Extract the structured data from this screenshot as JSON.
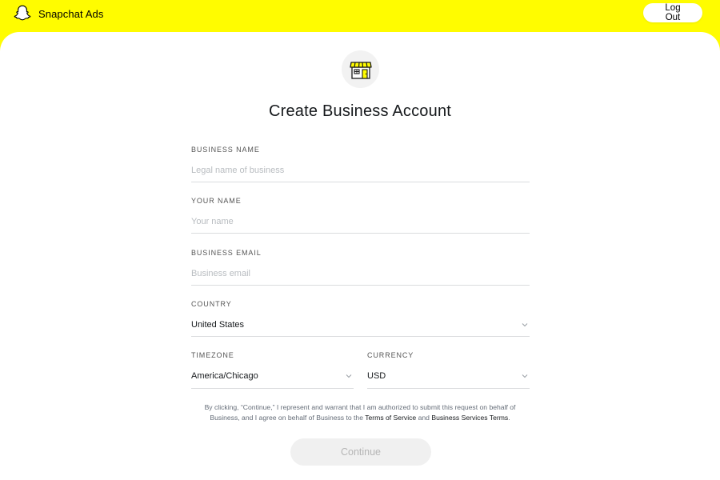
{
  "header": {
    "brand_name": "Snapchat Ads",
    "logout_label": "Log Out"
  },
  "form": {
    "title": "Create Business Account",
    "business_name": {
      "label": "BUSINESS NAME",
      "placeholder": "Legal name of business",
      "value": ""
    },
    "your_name": {
      "label": "YOUR NAME",
      "placeholder": "Your name",
      "value": ""
    },
    "business_email": {
      "label": "BUSINESS EMAIL",
      "placeholder": "Business email",
      "value": ""
    },
    "country": {
      "label": "COUNTRY",
      "value": "United States"
    },
    "timezone": {
      "label": "TIMEZONE",
      "value": "America/Chicago"
    },
    "currency": {
      "label": "CURRENCY",
      "value": "USD"
    }
  },
  "legal": {
    "text_part1": "By clicking, “Continue,” I represent and warrant that I am authorized to submit this request on behalf of Business, and I agree on behalf of Business to the ",
    "terms_link": "Terms of Service",
    "text_and": " and ",
    "business_terms_link": "Business Services Terms",
    "text_end": "."
  },
  "continue_label": "Continue",
  "colors": {
    "brand_yellow": "#FFFC00",
    "text_dark": "#16191C",
    "placeholder": "#B8BCC0"
  },
  "icons": {
    "brand": "snapchat-ghost-icon",
    "store": "storefront-icon",
    "dropdown": "chevron-down-icon"
  }
}
